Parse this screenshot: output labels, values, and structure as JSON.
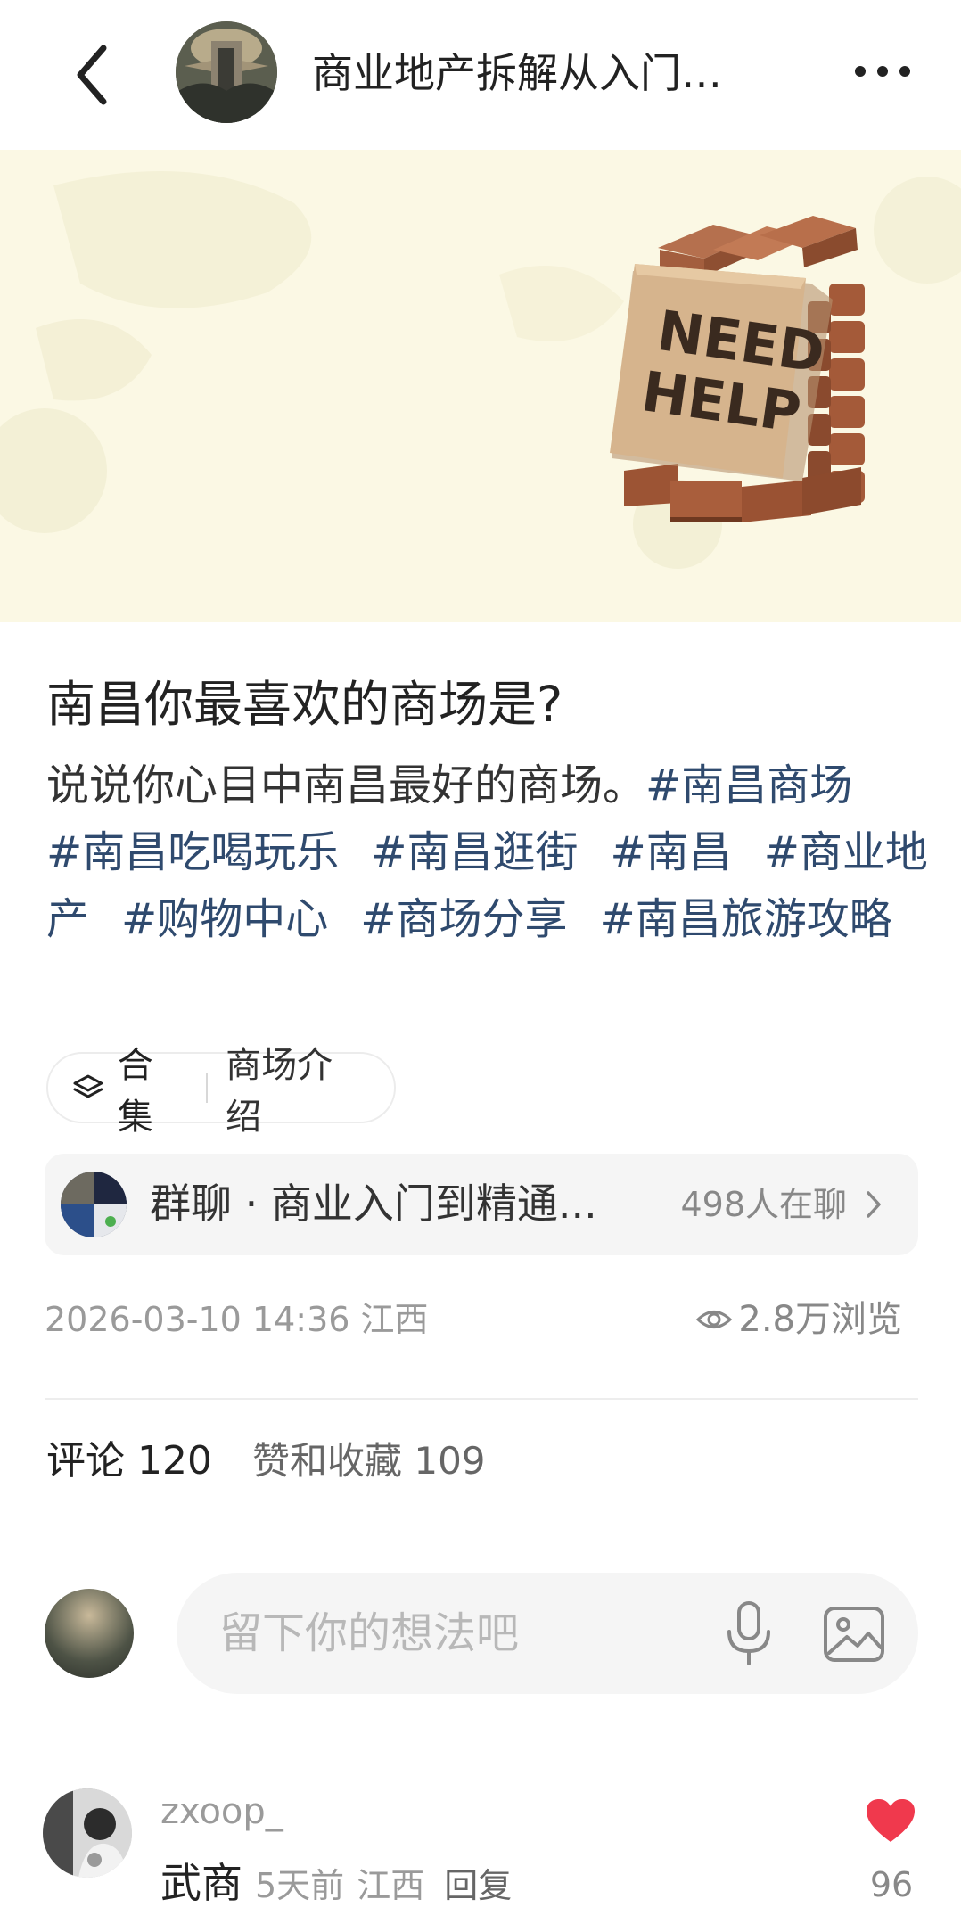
{
  "header": {
    "title": "商业地产拆解从入门…",
    "back_icon": "chevron-left-icon",
    "more_icon": "more-horizontal-icon"
  },
  "banner": {
    "sign_text_line1": "NEED",
    "sign_text_line2": "HELP",
    "background_color": "#fbf8e4"
  },
  "post": {
    "title": "南昌你最喜欢的商场是?",
    "body_text": "说说你心目中南昌最好的商场。",
    "tags": [
      "#南昌商场",
      "#南昌吃喝玩乐",
      "#南昌逛街",
      "#南昌",
      "#商业地产",
      "#购物中心",
      "#商场分享",
      "#南昌旅游攻略"
    ],
    "tag_color": "#2f4a6e"
  },
  "collection": {
    "label": "合集",
    "value": "商场介绍",
    "icon": "layers-icon"
  },
  "group_chat": {
    "name": "群聊 · 商业入门到精通...",
    "count_text": "498人在聊"
  },
  "meta": {
    "date_location": "2026-03-10 14:36 江西",
    "views": "2.8万浏览"
  },
  "tabs": {
    "comments": "评论 120",
    "likes": "赞和收藏 109"
  },
  "comment_input": {
    "placeholder": "留下你的想法吧"
  },
  "comments": [
    {
      "username": "zxoop_",
      "text": "武商",
      "time": "5天前",
      "location": "江西",
      "reply_label": "回复",
      "likes": "96",
      "like_color": "#f0394d"
    }
  ]
}
